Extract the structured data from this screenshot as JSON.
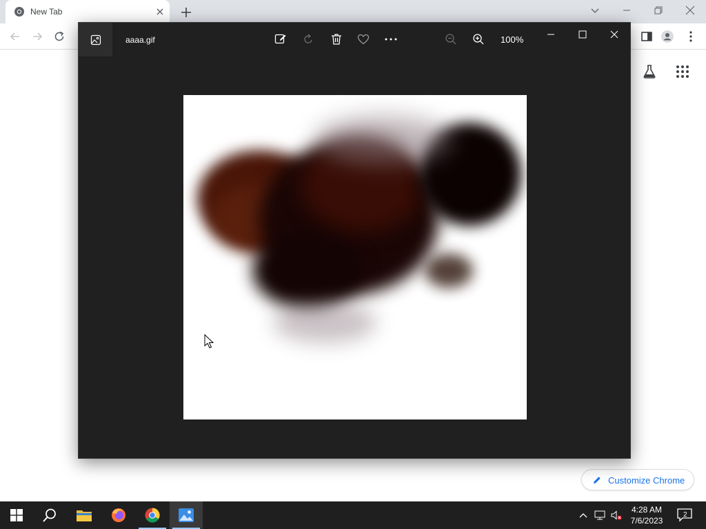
{
  "browser": {
    "tab_title": "New Tab",
    "customize_label": "Customize Chrome"
  },
  "photos": {
    "filename": "aaaa.gif",
    "zoom": "100%"
  },
  "taskbar": {
    "time": "4:28 AM",
    "date": "7/6/2023",
    "notification_count": "2"
  },
  "colors": {
    "chrome_tabstrip": "#dee1e6",
    "photos_background": "#202020",
    "taskbar_background": "#1f1f1f",
    "chrome_link_blue": "#1a73e8",
    "image_blob_dark": "#1a0605",
    "image_blob_brown": "#4a1608"
  },
  "icons": {
    "tab_favicon": "chrome-icon",
    "photos_app": "image-icon",
    "edit": "edit-image-icon",
    "rotate": "rotate-icon",
    "delete": "trash-icon",
    "favorite": "heart-icon",
    "more": "more-icon",
    "zoom_out": "zoom-out-icon",
    "zoom_in": "zoom-in-icon"
  }
}
